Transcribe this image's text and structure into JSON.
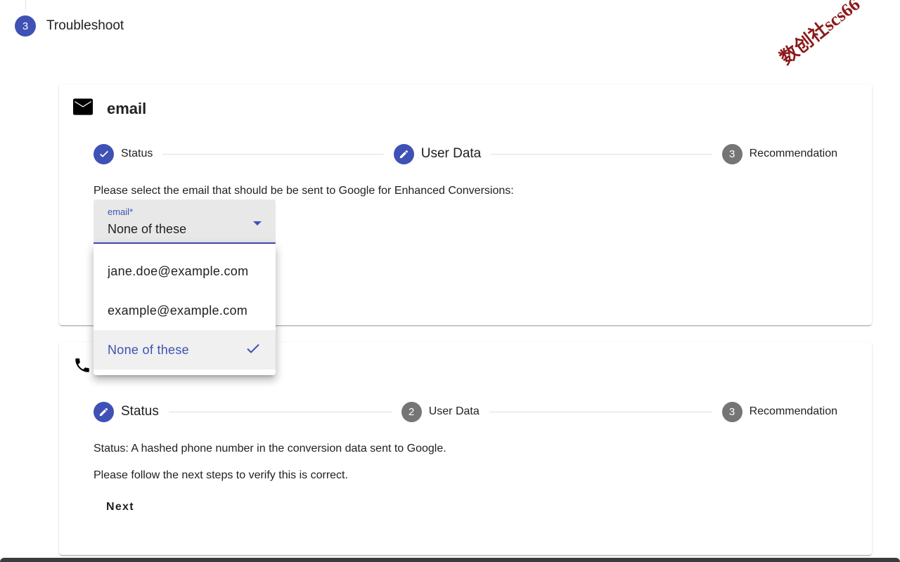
{
  "troubleshoot": {
    "step_number": "3",
    "label": "Troubleshoot"
  },
  "watermark": "数创社scs66",
  "email_card": {
    "title": "email",
    "icon": "email-icon",
    "steps": [
      {
        "label": "Status",
        "state": "done"
      },
      {
        "label": "User Data",
        "state": "active"
      },
      {
        "label": "Recommendation",
        "state": "pending",
        "number": "3"
      }
    ],
    "instruction": "Please select the email that should be be sent to Google for Enhanced Conversions:",
    "select": {
      "float_label": "email*",
      "value": "None of these",
      "options": [
        "jane.doe@example.com",
        "example@example.com",
        "None of these"
      ],
      "selected_index": 2
    }
  },
  "phone_card": {
    "icon": "phone-icon",
    "steps": [
      {
        "label": "Status",
        "state": "active"
      },
      {
        "label": "User Data",
        "state": "pending",
        "number": "2"
      },
      {
        "label": "Recommendation",
        "state": "pending",
        "number": "3"
      }
    ],
    "status_text": "Status: A hashed phone number in the conversion data sent to Google.",
    "follow_text": "Please follow the next steps to verify this is correct.",
    "next_label": "Next"
  },
  "colors": {
    "primary": "#3f51b5",
    "pending_step": "#757575",
    "watermark": "#8b1a1a"
  }
}
